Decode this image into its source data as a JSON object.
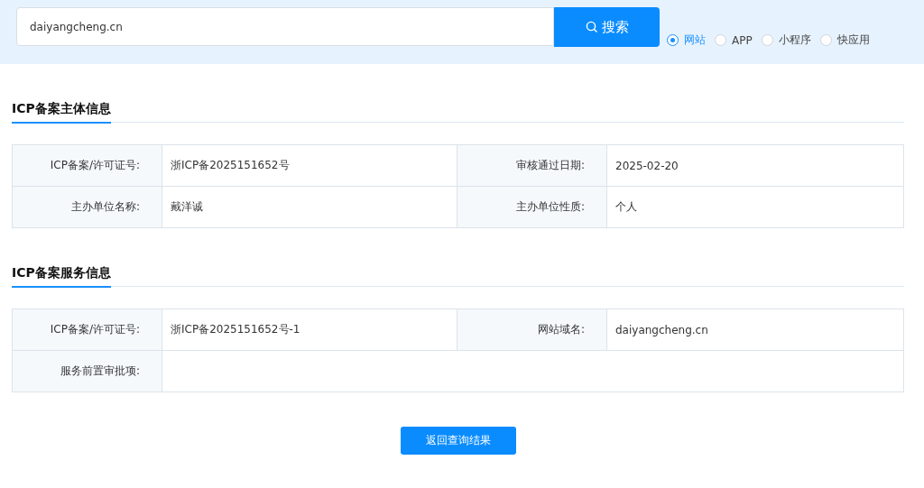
{
  "search": {
    "value": "daiyangcheng.cn",
    "button": "搜索"
  },
  "types": [
    {
      "label": "网站",
      "selected": true
    },
    {
      "label": "APP",
      "selected": false
    },
    {
      "label": "小程序",
      "selected": false
    },
    {
      "label": "快应用",
      "selected": false
    }
  ],
  "sections": [
    {
      "title": "ICP备案主体信息",
      "rows": [
        [
          {
            "label": "ICP备案/许可证号:",
            "value": "浙ICP备2025151652号"
          },
          {
            "label": "审核通过日期:",
            "value": "2025-02-20"
          }
        ],
        [
          {
            "label": "主办单位名称:",
            "value": "戴洋诚"
          },
          {
            "label": "主办单位性质:",
            "value": "个人"
          }
        ]
      ]
    },
    {
      "title": "ICP备案服务信息",
      "rows": [
        [
          {
            "label": "ICP备案/许可证号:",
            "value": "浙ICP备2025151652号-1"
          },
          {
            "label": "网站域名:",
            "value": "daiyangcheng.cn"
          }
        ],
        [
          {
            "label": "服务前置审批项:"
          }
        ]
      ]
    }
  ],
  "back_button": "返回查询结果"
}
